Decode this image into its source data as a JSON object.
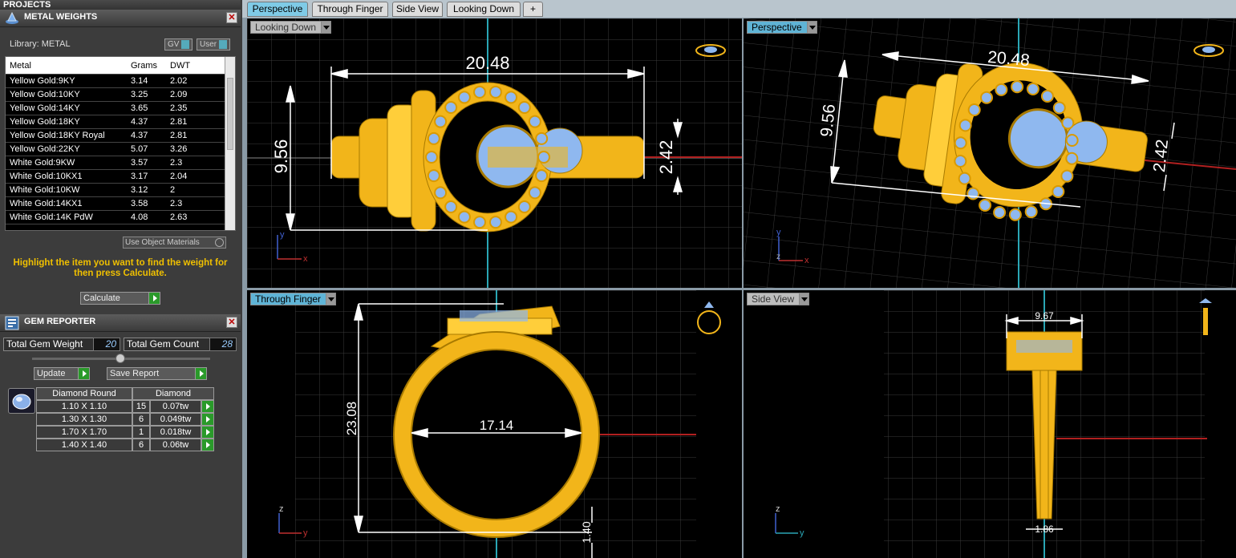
{
  "projects_label": "PROJECTS",
  "metal_weights": {
    "title": "METAL WEIGHTS",
    "library": "Library: METAL",
    "toggle_gv": "GV",
    "toggle_user": "User",
    "columns": [
      "Metal",
      "Grams",
      "DWT"
    ],
    "rows": [
      {
        "metal": "Yellow Gold:9KY",
        "grams": "3.14",
        "dwt": "2.02"
      },
      {
        "metal": "Yellow Gold:10KY",
        "grams": "3.25",
        "dwt": "2.09"
      },
      {
        "metal": "Yellow Gold:14KY",
        "grams": "3.65",
        "dwt": "2.35"
      },
      {
        "metal": "Yellow Gold:18KY",
        "grams": "4.37",
        "dwt": "2.81"
      },
      {
        "metal": "Yellow Gold:18KY Royal",
        "grams": "4.37",
        "dwt": "2.81"
      },
      {
        "metal": "Yellow Gold:22KY",
        "grams": "5.07",
        "dwt": "3.26"
      },
      {
        "metal": "White Gold:9KW",
        "grams": "3.57",
        "dwt": "2.3"
      },
      {
        "metal": "White Gold:10KX1",
        "grams": "3.17",
        "dwt": "2.04"
      },
      {
        "metal": "White Gold:10KW",
        "grams": "3.12",
        "dwt": "2"
      },
      {
        "metal": "White Gold:14KX1",
        "grams": "3.58",
        "dwt": "2.3"
      },
      {
        "metal": "White Gold:14K PdW",
        "grams": "4.08",
        "dwt": "2.63"
      }
    ],
    "use_object_materials": "Use Object Materials",
    "hint": "Highlight the item you want to find the weight for then press Calculate.",
    "calculate": "Calculate"
  },
  "gem_reporter": {
    "title": "GEM REPORTER",
    "total_weight_label": "Total Gem Weight",
    "total_weight": "20",
    "total_count_label": "Total Gem Count",
    "total_count": "28",
    "update": "Update",
    "save_report": "Save Report",
    "col1": "Diamond Round",
    "col2": "Diamond",
    "rows": [
      {
        "size": "1.10 X 1.10",
        "count": "15",
        "weight": "0.07tw"
      },
      {
        "size": "1.30 X 1.30",
        "count": "6",
        "weight": "0.049tw"
      },
      {
        "size": "1.70 X 1.70",
        "count": "1",
        "weight": "0.018tw"
      },
      {
        "size": "1.40 X 1.40",
        "count": "6",
        "weight": "0.06tw"
      }
    ]
  },
  "tabs": [
    "Perspective",
    "Through Finger",
    "Side View",
    "Looking Down",
    "+"
  ],
  "viewports": {
    "looking_down": {
      "label": "Looking Down",
      "dim_width": "20.48",
      "dim_height": "9.56",
      "dim_small": "2.42"
    },
    "perspective": {
      "label": "Perspective",
      "dim_width": "20.48",
      "dim_height": "9.56",
      "dim_small": "2.42"
    },
    "through_finger": {
      "label": "Through Finger",
      "dim_height": "23.08",
      "dim_diameter": "17.14",
      "dim_small": "1.40"
    },
    "side_view": {
      "label": "Side View",
      "dim_top": "9.67",
      "dim_bottom": "1.86"
    }
  },
  "axes": {
    "x": "x",
    "y": "y",
    "z": "z"
  },
  "colors": {
    "gold": "#f2b51a",
    "gem": "#8fb8ef",
    "grid": "#3a3a3a",
    "tab_active": "#7fcbe7"
  }
}
